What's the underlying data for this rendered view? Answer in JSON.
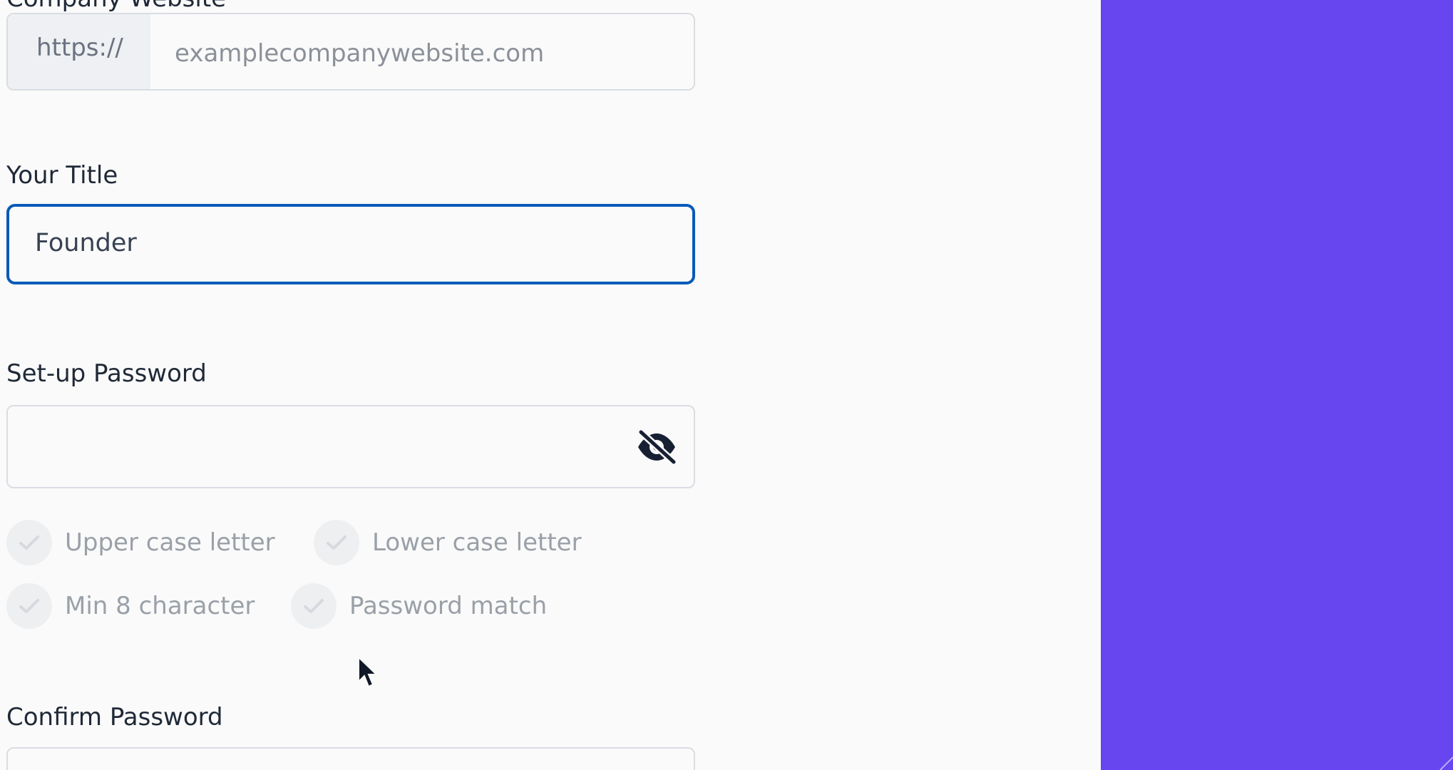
{
  "form": {
    "website": {
      "label": "Company Website",
      "prefix": "https://",
      "placeholder": "examplecompanywebsite.com"
    },
    "title": {
      "label": "Your Title",
      "value": "Founder"
    },
    "password": {
      "label": "Set-up Password",
      "value": "",
      "visibility_icon": "eye-slash-icon"
    },
    "requirements": [
      {
        "label": "Upper case letter",
        "icon": "check-icon"
      },
      {
        "label": "Lower case letter",
        "icon": "check-icon"
      },
      {
        "label": "Min 8 character",
        "icon": "check-icon"
      },
      {
        "label": "Password match",
        "icon": "check-icon"
      }
    ],
    "confirm_password": {
      "label": "Confirm Password",
      "value": ""
    }
  },
  "theme": {
    "accent": "#6746f0",
    "focus_border": "#0a5ab8"
  }
}
